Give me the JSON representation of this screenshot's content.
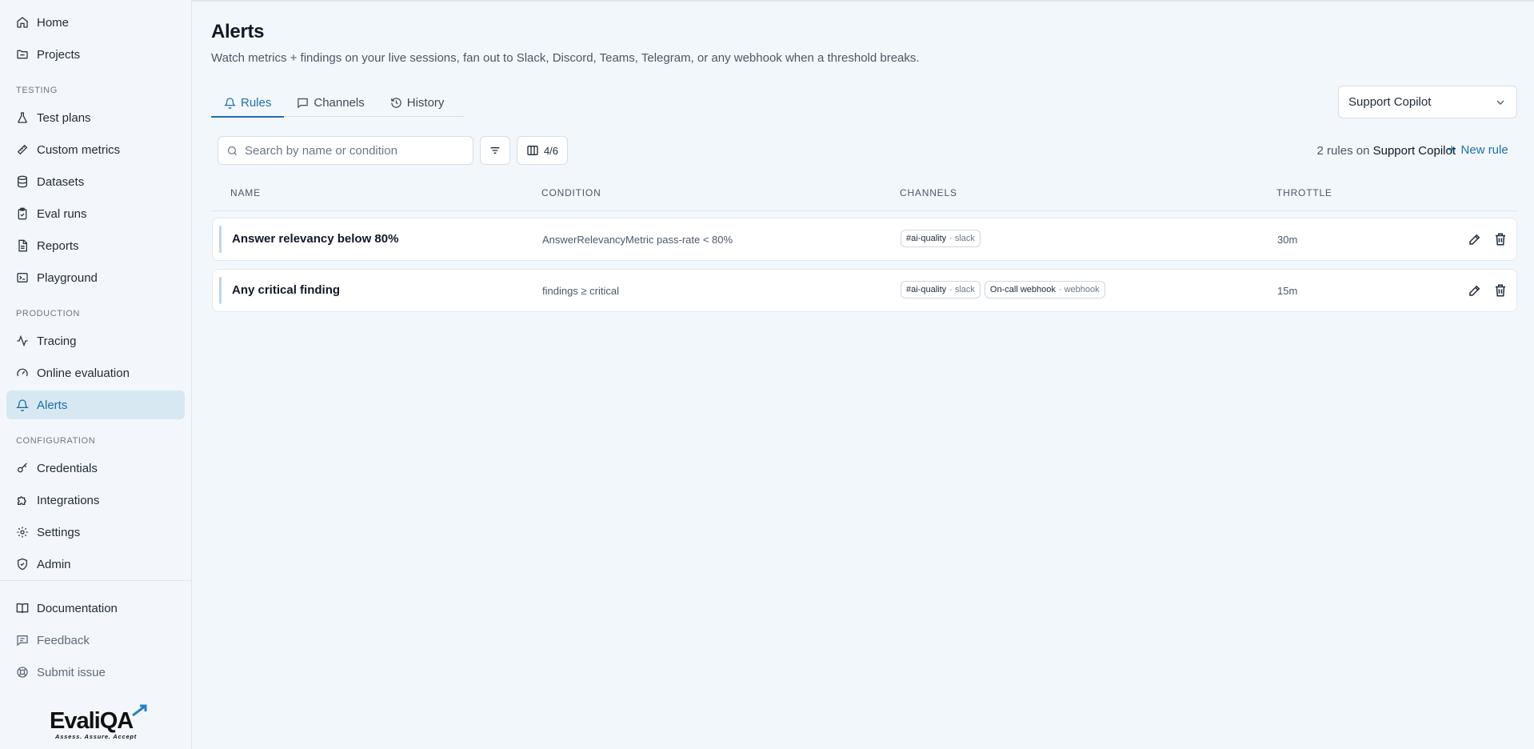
{
  "sidebar": {
    "top_items": [
      {
        "label": "Home",
        "icon": "home-icon"
      },
      {
        "label": "Projects",
        "icon": "folder-icon"
      }
    ],
    "sections": [
      {
        "label": "TESTING",
        "items": [
          {
            "label": "Test plans"
          },
          {
            "label": "Custom metrics"
          },
          {
            "label": "Datasets"
          },
          {
            "label": "Eval runs"
          },
          {
            "label": "Reports"
          },
          {
            "label": "Playground"
          }
        ]
      },
      {
        "label": "PRODUCTION",
        "items": [
          {
            "label": "Tracing"
          },
          {
            "label": "Online evaluation"
          },
          {
            "label": "Alerts",
            "active": true
          }
        ]
      },
      {
        "label": "CONFIGURATION",
        "items": [
          {
            "label": "Credentials"
          },
          {
            "label": "Integrations"
          },
          {
            "label": "Settings"
          },
          {
            "label": "Admin"
          }
        ]
      }
    ],
    "bottom_items": [
      {
        "label": "Documentation"
      },
      {
        "label": "Feedback"
      },
      {
        "label": "Submit issue"
      }
    ],
    "logo_text": "EvaliQA",
    "logo_tagline": "Assess. Assure. Accept"
  },
  "header": {
    "title": "Alerts",
    "subtitle": "Watch metrics + findings on your live sessions, fan out to Slack, Discord, Teams, Telegram, or any webhook when a threshold breaks."
  },
  "tabs": [
    {
      "label": "Rules",
      "active": true
    },
    {
      "label": "Channels"
    },
    {
      "label": "History"
    }
  ],
  "project_select": {
    "value": "Support Copilot"
  },
  "toolbar": {
    "search_placeholder": "Search by name or condition",
    "columns_label": "4/6",
    "rules_count_prefix": "2 rules on",
    "rules_count_project": "Support Copilot",
    "new_rule_label": "New rule"
  },
  "table": {
    "columns": [
      "NAME",
      "CONDITION",
      "CHANNELS",
      "THROTTLE"
    ],
    "rows": [
      {
        "name": "Answer relevancy below 80%",
        "condition": "AnswerRelevancyMetric pass-rate < 80%",
        "channels": [
          {
            "name": "#ai-quality",
            "kind": "· slack"
          }
        ],
        "throttle": "30m"
      },
      {
        "name": "Any critical finding",
        "condition": "findings ≥ critical",
        "channels": [
          {
            "name": "#ai-quality",
            "kind": "· slack"
          },
          {
            "name": "On-call webhook",
            "kind": "· webhook"
          }
        ],
        "throttle": "15m"
      }
    ]
  },
  "colors": {
    "accent": "#1f6fa6",
    "active_bg": "#d7e8f3",
    "background": "#f2f7fb"
  }
}
